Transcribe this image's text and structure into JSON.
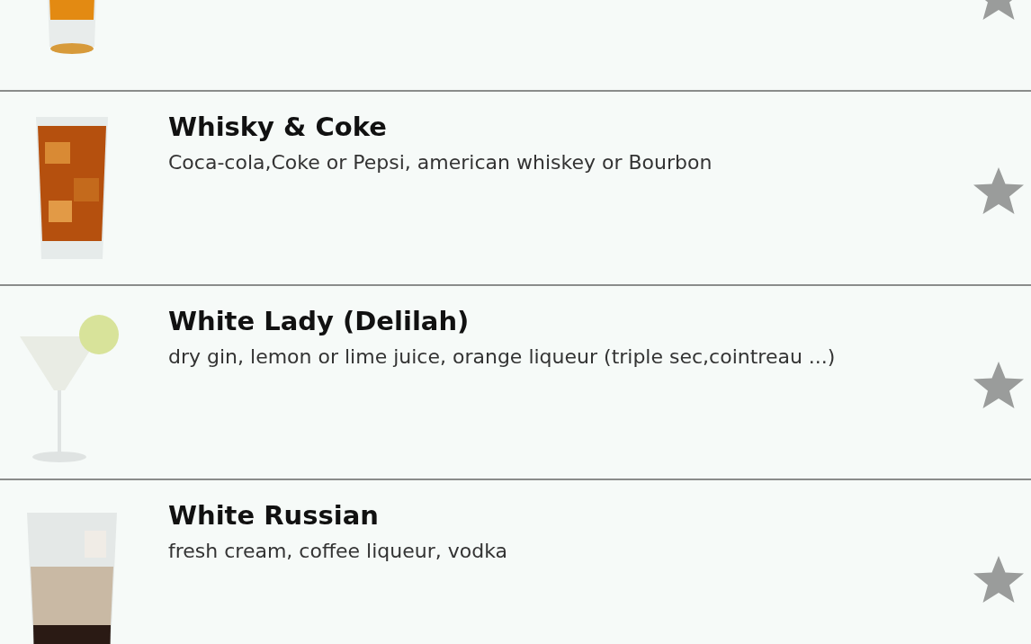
{
  "drinks": [
    {
      "kind": "cut",
      "favorite": false
    },
    {
      "kind": "full",
      "name": "Whisky & Coke",
      "ingredients": "Coca-cola,Coke or Pepsi, american whiskey or Bourbon",
      "favorite": false
    },
    {
      "kind": "full",
      "name": "White Lady (Delilah)",
      "ingredients": "dry gin, lemon or lime juice, orange liqueur (triple sec,cointreau ...)",
      "favorite": false
    },
    {
      "kind": "full",
      "name": "White Russian",
      "ingredients": "fresh cream, coffee liqueur, vodka",
      "favorite": false
    }
  ]
}
